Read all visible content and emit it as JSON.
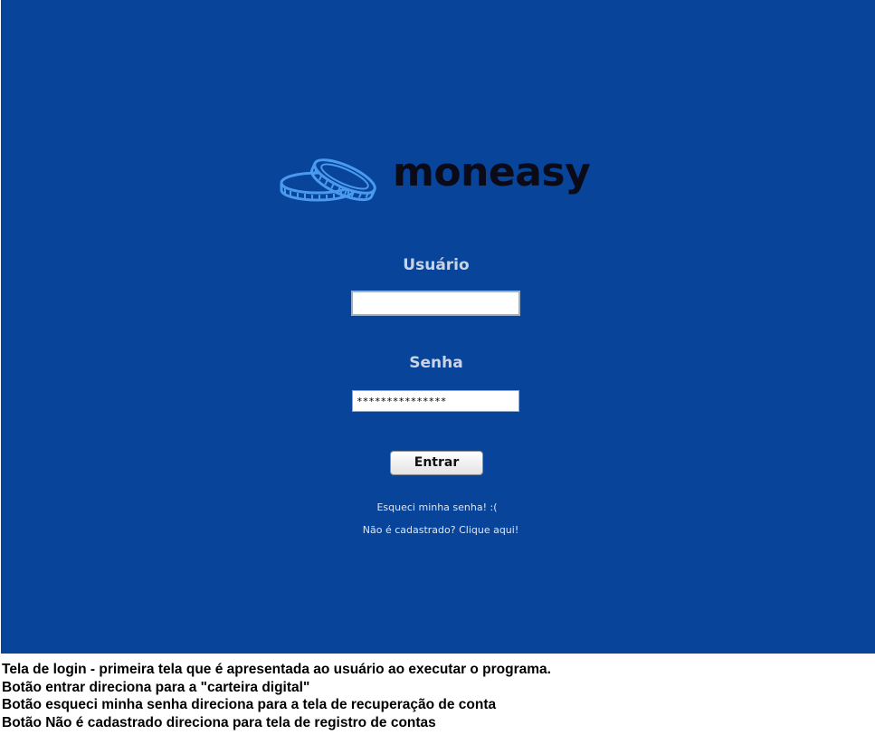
{
  "app": {
    "brand_name": "moneasy",
    "logo_icon": "coins-icon",
    "background_color": "#07449a",
    "logo_accent_color": "#4a9bf0"
  },
  "login": {
    "user_label": "Usuário",
    "user_value": "",
    "password_label": "Senha",
    "password_value": "***************",
    "enter_button": "Entrar",
    "forgot_link": "Esqueci minha senha! :(",
    "register_link": "Não é cadastrado? Clique aqui!"
  },
  "caption": {
    "lines": [
      "Tela de login - primeira tela que é apresentada ao usuário ao executar o programa.",
      "Botão entrar direciona para a \"carteira digital\"",
      "Botão esqueci minha senha direciona para a tela de recuperação de conta",
      "Botão Não é cadastrado direciona para tela de registro de contas"
    ]
  }
}
